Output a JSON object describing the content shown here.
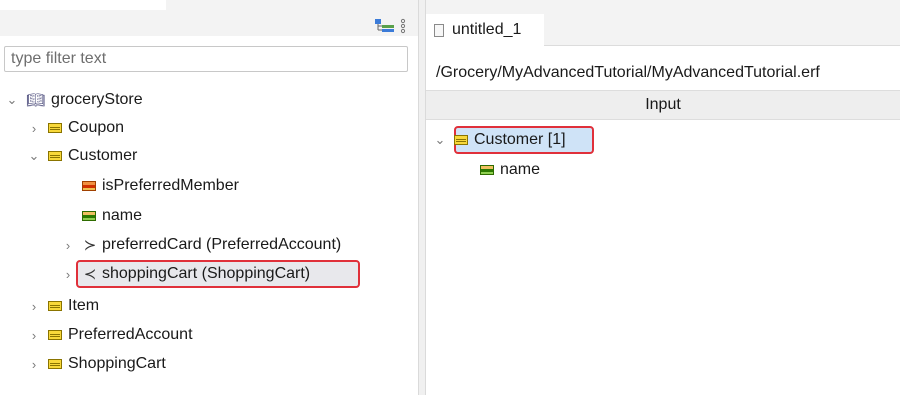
{
  "left": {
    "filter_placeholder": "type filter text",
    "toolbar_icons": [
      "collapse-all-icon",
      "view-menu-icon"
    ],
    "tree": {
      "root": "groceryStore",
      "items": [
        {
          "label": "Coupon",
          "icon": "class-icon",
          "expanded": false
        },
        {
          "label": "Customer",
          "icon": "class-icon",
          "expanded": true
        },
        {
          "label": "isPreferredMember",
          "icon": "attribute-icon"
        },
        {
          "label": "name",
          "icon": "attribute-icon"
        },
        {
          "label": "preferredCard (PreferredAccount)",
          "icon": "reference-icon",
          "expanded": false
        },
        {
          "label": "shoppingCart (ShoppingCart)",
          "icon": "reference-icon",
          "expanded": false,
          "highlighted": true
        },
        {
          "label": "Item",
          "icon": "class-icon",
          "expanded": false
        },
        {
          "label": "PreferredAccount",
          "icon": "class-icon",
          "expanded": false
        },
        {
          "label": "ShoppingCart",
          "icon": "class-icon",
          "expanded": false
        }
      ]
    }
  },
  "editor": {
    "tab_label": "untitled_1",
    "path": "/Grocery/MyAdvancedTutorial/MyAdvancedTutorial.erf",
    "column_header": "Input",
    "tree": [
      {
        "label": "Customer [1]",
        "icon": "class-icon",
        "expanded": true,
        "selected": true
      },
      {
        "label": "name",
        "icon": "attribute-icon"
      }
    ]
  },
  "colors": {
    "highlight_border": "#e0303a",
    "selection": "#cfe3f7",
    "class_icon": "#f8d83a"
  }
}
